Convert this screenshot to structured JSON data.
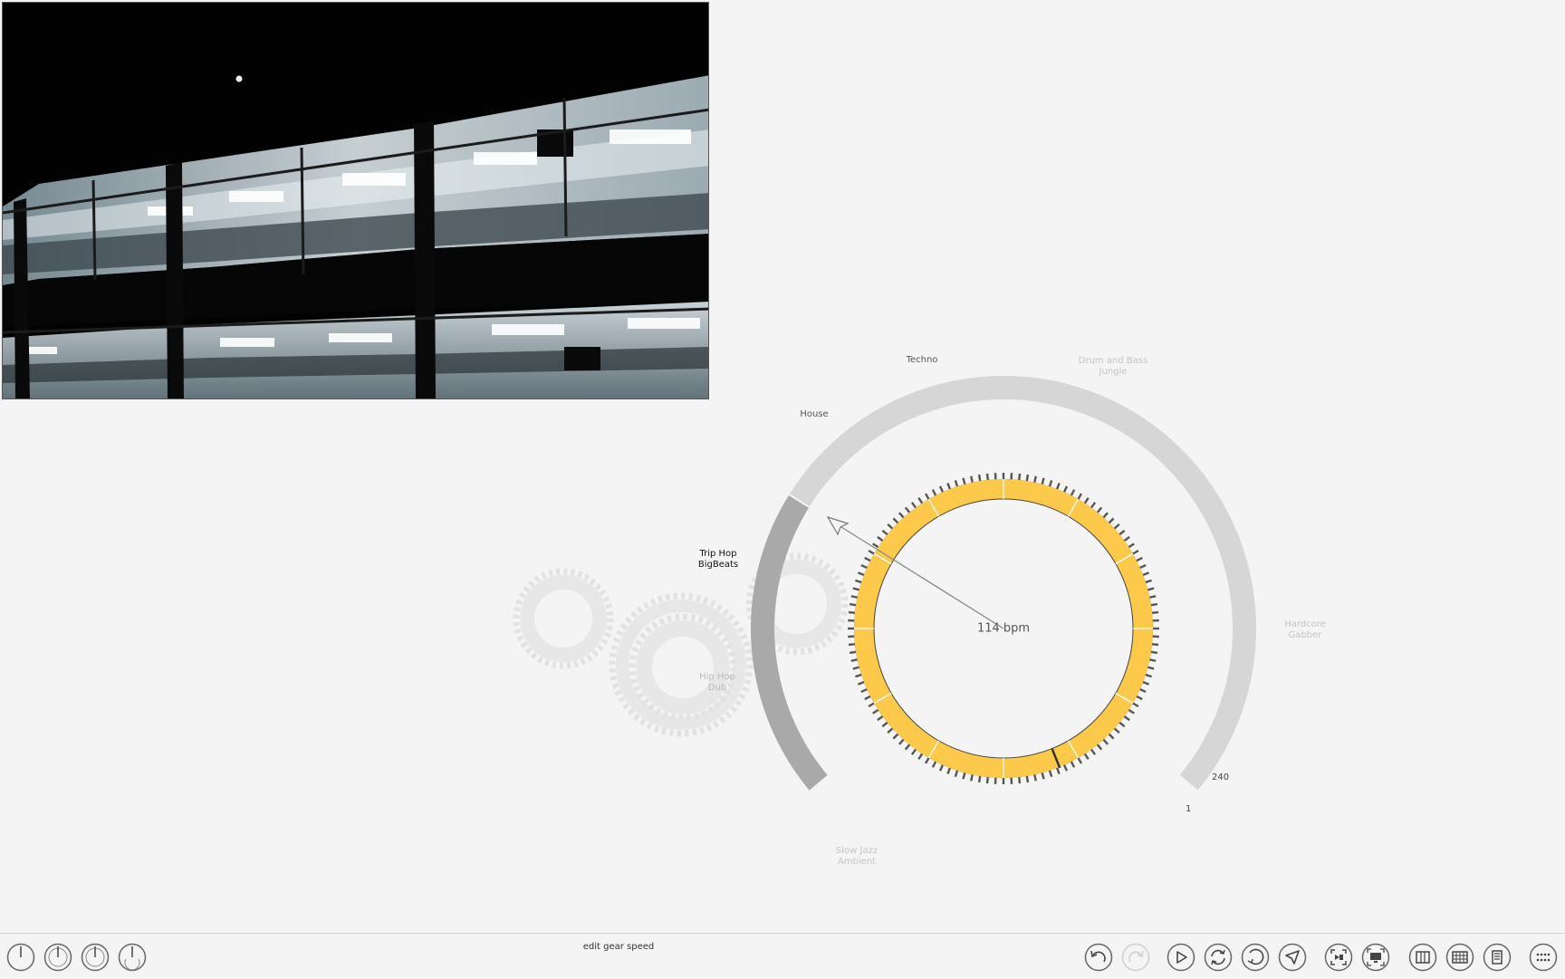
{
  "gear_ring": {
    "genres": [
      {
        "name": "Techno",
        "lines": [
          "Techno"
        ],
        "state": "near"
      },
      {
        "name": "Drum and Bass Jungle",
        "lines": [
          "Drum and Bass",
          "Jungle"
        ],
        "state": "far"
      },
      {
        "name": "House",
        "lines": [
          "House"
        ],
        "state": "near"
      },
      {
        "name": "Trip Hop BigBeats",
        "lines": [
          "Trip Hop",
          "BigBeats"
        ],
        "state": "active"
      },
      {
        "name": "Hip Hop Dub",
        "lines": [
          "Hip Hop",
          "Dub"
        ],
        "state": "far"
      },
      {
        "name": "Hardcore Gabber",
        "lines": [
          "Hardcore",
          "Gabber"
        ],
        "state": "far"
      },
      {
        "name": "Slow Jazz Ambient",
        "lines": [
          "Slow Jazz",
          "Ambient"
        ],
        "state": "far"
      }
    ],
    "scale_max": "240",
    "scale_min": "1",
    "bpm_value": 114,
    "bpm_text": "114 bpm",
    "accent_color": "#fdc94a",
    "ring_color": "#d6d6d6",
    "active_segment_color": "#a9a9a9"
  },
  "statusbar": {
    "message": "edit gear speed"
  },
  "left_buttons": [
    {
      "name": "power-button-1",
      "icon": "power-icon"
    },
    {
      "name": "power-button-2",
      "icon": "power-icon"
    },
    {
      "name": "power-button-3",
      "icon": "power-icon"
    },
    {
      "name": "power-button-4",
      "icon": "power-icon"
    }
  ],
  "right_buttons": [
    {
      "name": "undo-button",
      "icon": "undo-icon",
      "enabled": true
    },
    {
      "name": "redo-button",
      "icon": "redo-icon",
      "enabled": false
    },
    {
      "name": "play-button",
      "icon": "play-icon",
      "enabled": true
    },
    {
      "name": "loop-button",
      "icon": "loop-icon",
      "enabled": true
    },
    {
      "name": "rotate-button",
      "icon": "rotate-icon",
      "enabled": true
    },
    {
      "name": "pointer-button",
      "icon": "pointer-icon",
      "enabled": true
    },
    {
      "name": "fit-view-button",
      "icon": "fit-view-icon",
      "enabled": true
    },
    {
      "name": "display-output-button",
      "icon": "display-icon",
      "enabled": true
    },
    {
      "name": "columns-view-button",
      "icon": "columns-icon",
      "enabled": true
    },
    {
      "name": "grid-view-button",
      "icon": "grid-icon",
      "enabled": true
    },
    {
      "name": "list-view-button",
      "icon": "list-icon",
      "enabled": true
    },
    {
      "name": "more-button",
      "icon": "more-icon",
      "enabled": true
    }
  ]
}
